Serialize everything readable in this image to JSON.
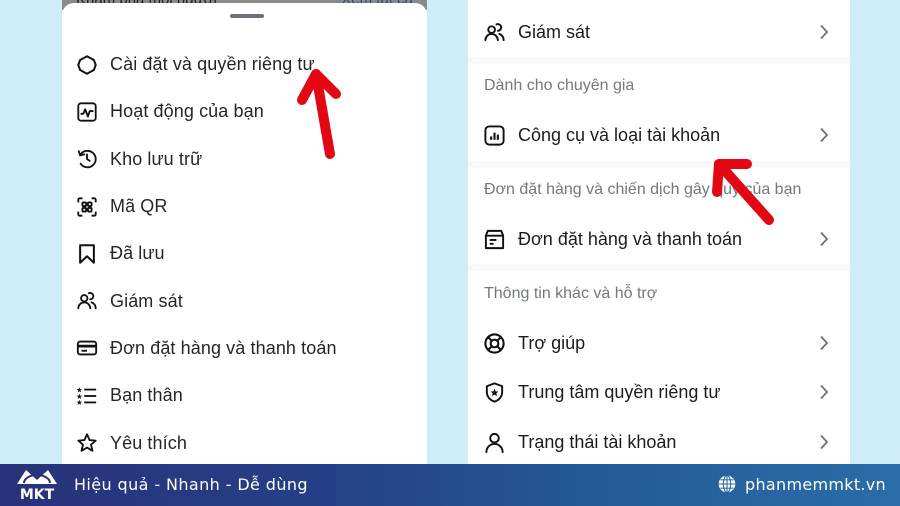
{
  "left_panel": {
    "background_peek": {
      "left_text": "Khám phá mọi người",
      "right_text": "Xem tất cả"
    },
    "menu_items": [
      {
        "icon": "settings-gear-icon",
        "label": "Cài đặt và quyền riêng tư"
      },
      {
        "icon": "activity-icon",
        "label": "Hoạt động của bạn"
      },
      {
        "icon": "archive-history-icon",
        "label": "Kho lưu trữ"
      },
      {
        "icon": "qr-code-icon",
        "label": "Mã QR"
      },
      {
        "icon": "bookmark-icon",
        "label": "Đã lưu"
      },
      {
        "icon": "supervision-icon",
        "label": "Giám sát"
      },
      {
        "icon": "credit-card-icon",
        "label": "Đơn đặt hàng và thanh toán"
      },
      {
        "icon": "close-friends-list-icon",
        "label": "Bạn thân"
      },
      {
        "icon": "star-icon",
        "label": "Yêu thích"
      }
    ]
  },
  "right_panel": {
    "top_item": {
      "icon": "supervision-icon",
      "label": "Giám sát"
    },
    "section_professional": {
      "header": "Dành cho chuyên gia",
      "items": [
        {
          "icon": "insights-icon",
          "label": "Công cụ và loại tài khoản"
        }
      ]
    },
    "section_orders": {
      "header": "Đơn đặt hàng và chiến dịch gây quỹ của bạn",
      "items": [
        {
          "icon": "orders-icon",
          "label": "Đơn đặt hàng và thanh toán"
        }
      ]
    },
    "section_support": {
      "header": "Thông tin khác và hỗ trợ",
      "items": [
        {
          "icon": "help-lifebuoy-icon",
          "label": "Trợ giúp"
        },
        {
          "icon": "privacy-shield-icon",
          "label": "Trung tâm quyền riêng tư"
        },
        {
          "icon": "account-status-icon",
          "label": "Trạng thái tài khoản"
        }
      ]
    }
  },
  "annotations": {
    "arrow_color": "#e30613"
  },
  "footer": {
    "brand": "MKT",
    "slogan": "Hiệu quả - Nhanh - Dễ dùng",
    "website": "phanmemmkt.vn"
  }
}
